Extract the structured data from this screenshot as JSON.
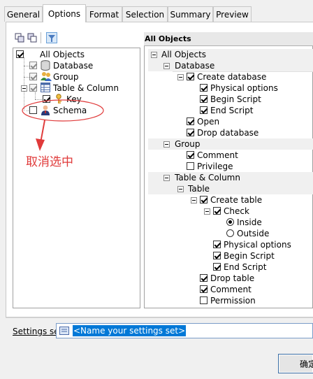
{
  "tabs": [
    {
      "label": "General"
    },
    {
      "label": "Options"
    },
    {
      "label": "Format"
    },
    {
      "label": "Selection"
    },
    {
      "label": "Summary"
    },
    {
      "label": "Preview"
    }
  ],
  "left_tree": [
    {
      "label": "All Objects",
      "checked": true
    },
    {
      "label": "Database",
      "checked": true
    },
    {
      "label": "Group",
      "checked": true
    },
    {
      "label": "Table & Column",
      "checked": true
    },
    {
      "label": "Key",
      "checked": true
    },
    {
      "label": "Schema",
      "checked": false
    }
  ],
  "annotation": {
    "text": "取消选中",
    "color": "#e03a3a"
  },
  "right_header": "All Objects",
  "right_tree": [
    {
      "label": "All Objects"
    },
    {
      "label": "Database"
    },
    {
      "label": "Create database",
      "checked": true
    },
    {
      "label": "Physical options",
      "checked": true
    },
    {
      "label": "Begin Script",
      "checked": true
    },
    {
      "label": "End Script",
      "checked": true
    },
    {
      "label": "Open",
      "checked": true
    },
    {
      "label": "Drop database",
      "checked": true
    },
    {
      "label": "Group"
    },
    {
      "label": "Comment",
      "checked": true
    },
    {
      "label": "Privilege",
      "checked": false
    },
    {
      "label": "Table & Column"
    },
    {
      "label": "Table"
    },
    {
      "label": "Create table",
      "checked": true
    },
    {
      "label": "Check",
      "checked": true
    },
    {
      "label": "Inside",
      "radio": true,
      "selected": true
    },
    {
      "label": "Outside",
      "radio": true,
      "selected": false
    },
    {
      "label": "Physical options",
      "checked": true
    },
    {
      "label": "Begin Script",
      "checked": true
    },
    {
      "label": "End Script",
      "checked": true
    },
    {
      "label": "Drop table",
      "checked": true
    },
    {
      "label": "Comment",
      "checked": true
    },
    {
      "label": "Permission",
      "checked": false
    }
  ],
  "settings": {
    "label": "Settings set:",
    "value": "<Name your settings set>"
  },
  "ok_button": "确定",
  "colors": {
    "selection": "#0078d7",
    "annotation": "#e03a3a",
    "header_bg": "#e8e8e8"
  }
}
